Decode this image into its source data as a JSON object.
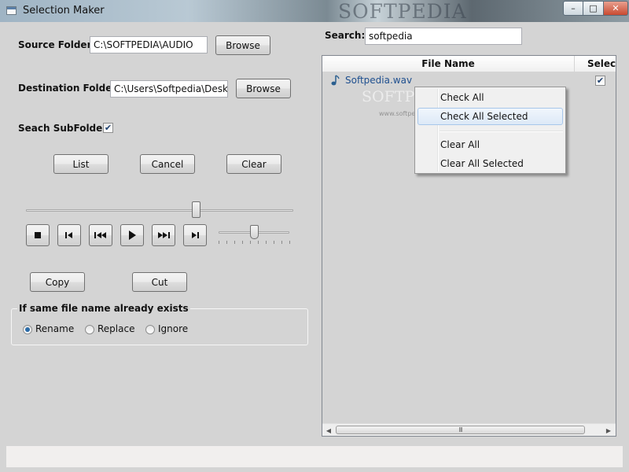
{
  "window": {
    "title": "Selection Maker",
    "watermark": "SOFTPEDIA",
    "controls": {
      "minimize": "–",
      "maximize": "□",
      "close": "✕"
    }
  },
  "left": {
    "source_label": "Source Folder:",
    "source_value": "C:\\SOFTPEDIA\\AUDIO",
    "browse_label": "Browse",
    "destination_label": "Destination Folder:",
    "destination_value": "C:\\Users\\Softpedia\\Desktop",
    "search_subfolders_label": "Seach SubFolders",
    "search_subfolders_checked": true,
    "list_label": "List",
    "cancel_label": "Cancel",
    "clear_label": "Clear",
    "position_slider": 0.64,
    "volume_slider": 0.5,
    "copy_label": "Copy",
    "cut_label": "Cut",
    "group_title": "If same file name already exists",
    "radios": [
      "Rename",
      "Replace",
      "Ignore"
    ],
    "selected_radio": "Rename"
  },
  "media_icons": [
    "stop-icon",
    "previous-icon",
    "rewind-icon",
    "play-icon",
    "fast-forward-icon",
    "next-icon"
  ],
  "search": {
    "label": "Search:",
    "value": "softpedia"
  },
  "grid": {
    "columns": [
      "File Name",
      "Select"
    ],
    "rows": [
      {
        "file_name": "Softpedia.wav",
        "selected": true,
        "icon": "audio-file-icon"
      }
    ],
    "scroll_grip": "III"
  },
  "context_menu": {
    "items": [
      "Check All",
      "Check All Selected",
      "Clear All",
      "Clear All Selected"
    ],
    "hovered": "Check All Selected"
  },
  "overlay_watermark": {
    "text": "SOFTPEDIA",
    "url": "www.softpedia.com"
  },
  "colors": {
    "accent": "#2c6ca8",
    "file_link": "#1e4f8f"
  }
}
